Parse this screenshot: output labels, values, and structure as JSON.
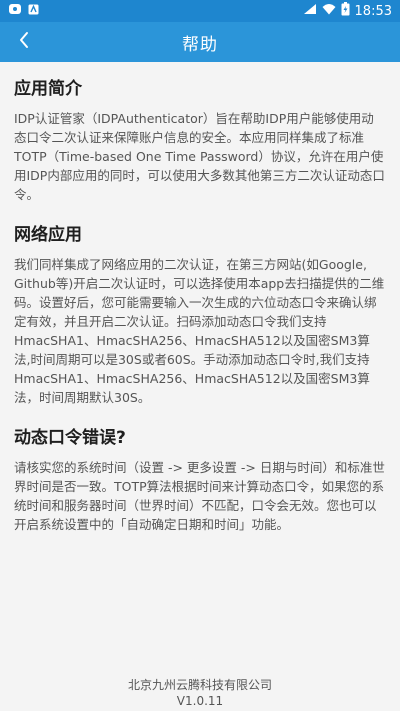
{
  "status_bar": {
    "time": "18:53",
    "left_icons": [
      "sim-card-icon",
      "app-notification-icon"
    ],
    "right_icons": [
      "signal-icon",
      "wifi-icon",
      "battery-icon"
    ]
  },
  "app_bar": {
    "title": "帮助",
    "back_icon": "chevron-left-icon"
  },
  "sections": [
    {
      "title": "应用简介",
      "body": "IDP认证管家（IDPAuthenticator）旨在帮助IDP用户能够使用动态口令二次认证来保障账户信息的安全。本应用同样集成了标准TOTP（Time-based One Time Password）协议，允许在用户使用IDP内部应用的同时，可以使用大多数其他第三方二次认证动态口令。"
    },
    {
      "title": "网络应用",
      "body": "我们同样集成了网络应用的二次认证，在第三方网站(如Google, Github等)开启二次认证时，可以选择使用本app去扫描提供的二维码。设置好后，您可能需要输入一次生成的六位动态口令来确认绑定有效，并且开启二次认证。扫码添加动态口令我们支持HmacSHA1、HmacSHA256、HmacSHA512以及国密SM3算法,时间周期可以是30S或者60S。手动添加动态口令时,我们支持HmacSHA1、HmacSHA256、HmacSHA512以及国密SM3算法，时间周期默认30S。"
    },
    {
      "title": "动态口令错误?",
      "body": "请核实您的系统时间（设置 -> 更多设置 -> 日期与时间）和标准世界时间是否一致。TOTP算法根据时间来计算动态口令，如果您的系统时间和服务器时间（世界时间）不匹配，口令会无效。您也可以开启系统设置中的「自动确定日期和时间」功能。"
    }
  ],
  "footer": {
    "company": "北京九州云腾科技有限公司",
    "version": "V1.0.11"
  },
  "colors": {
    "status_bar": "#1e86cf",
    "app_bar": "#2b95d9",
    "background": "#f4f4f4"
  }
}
